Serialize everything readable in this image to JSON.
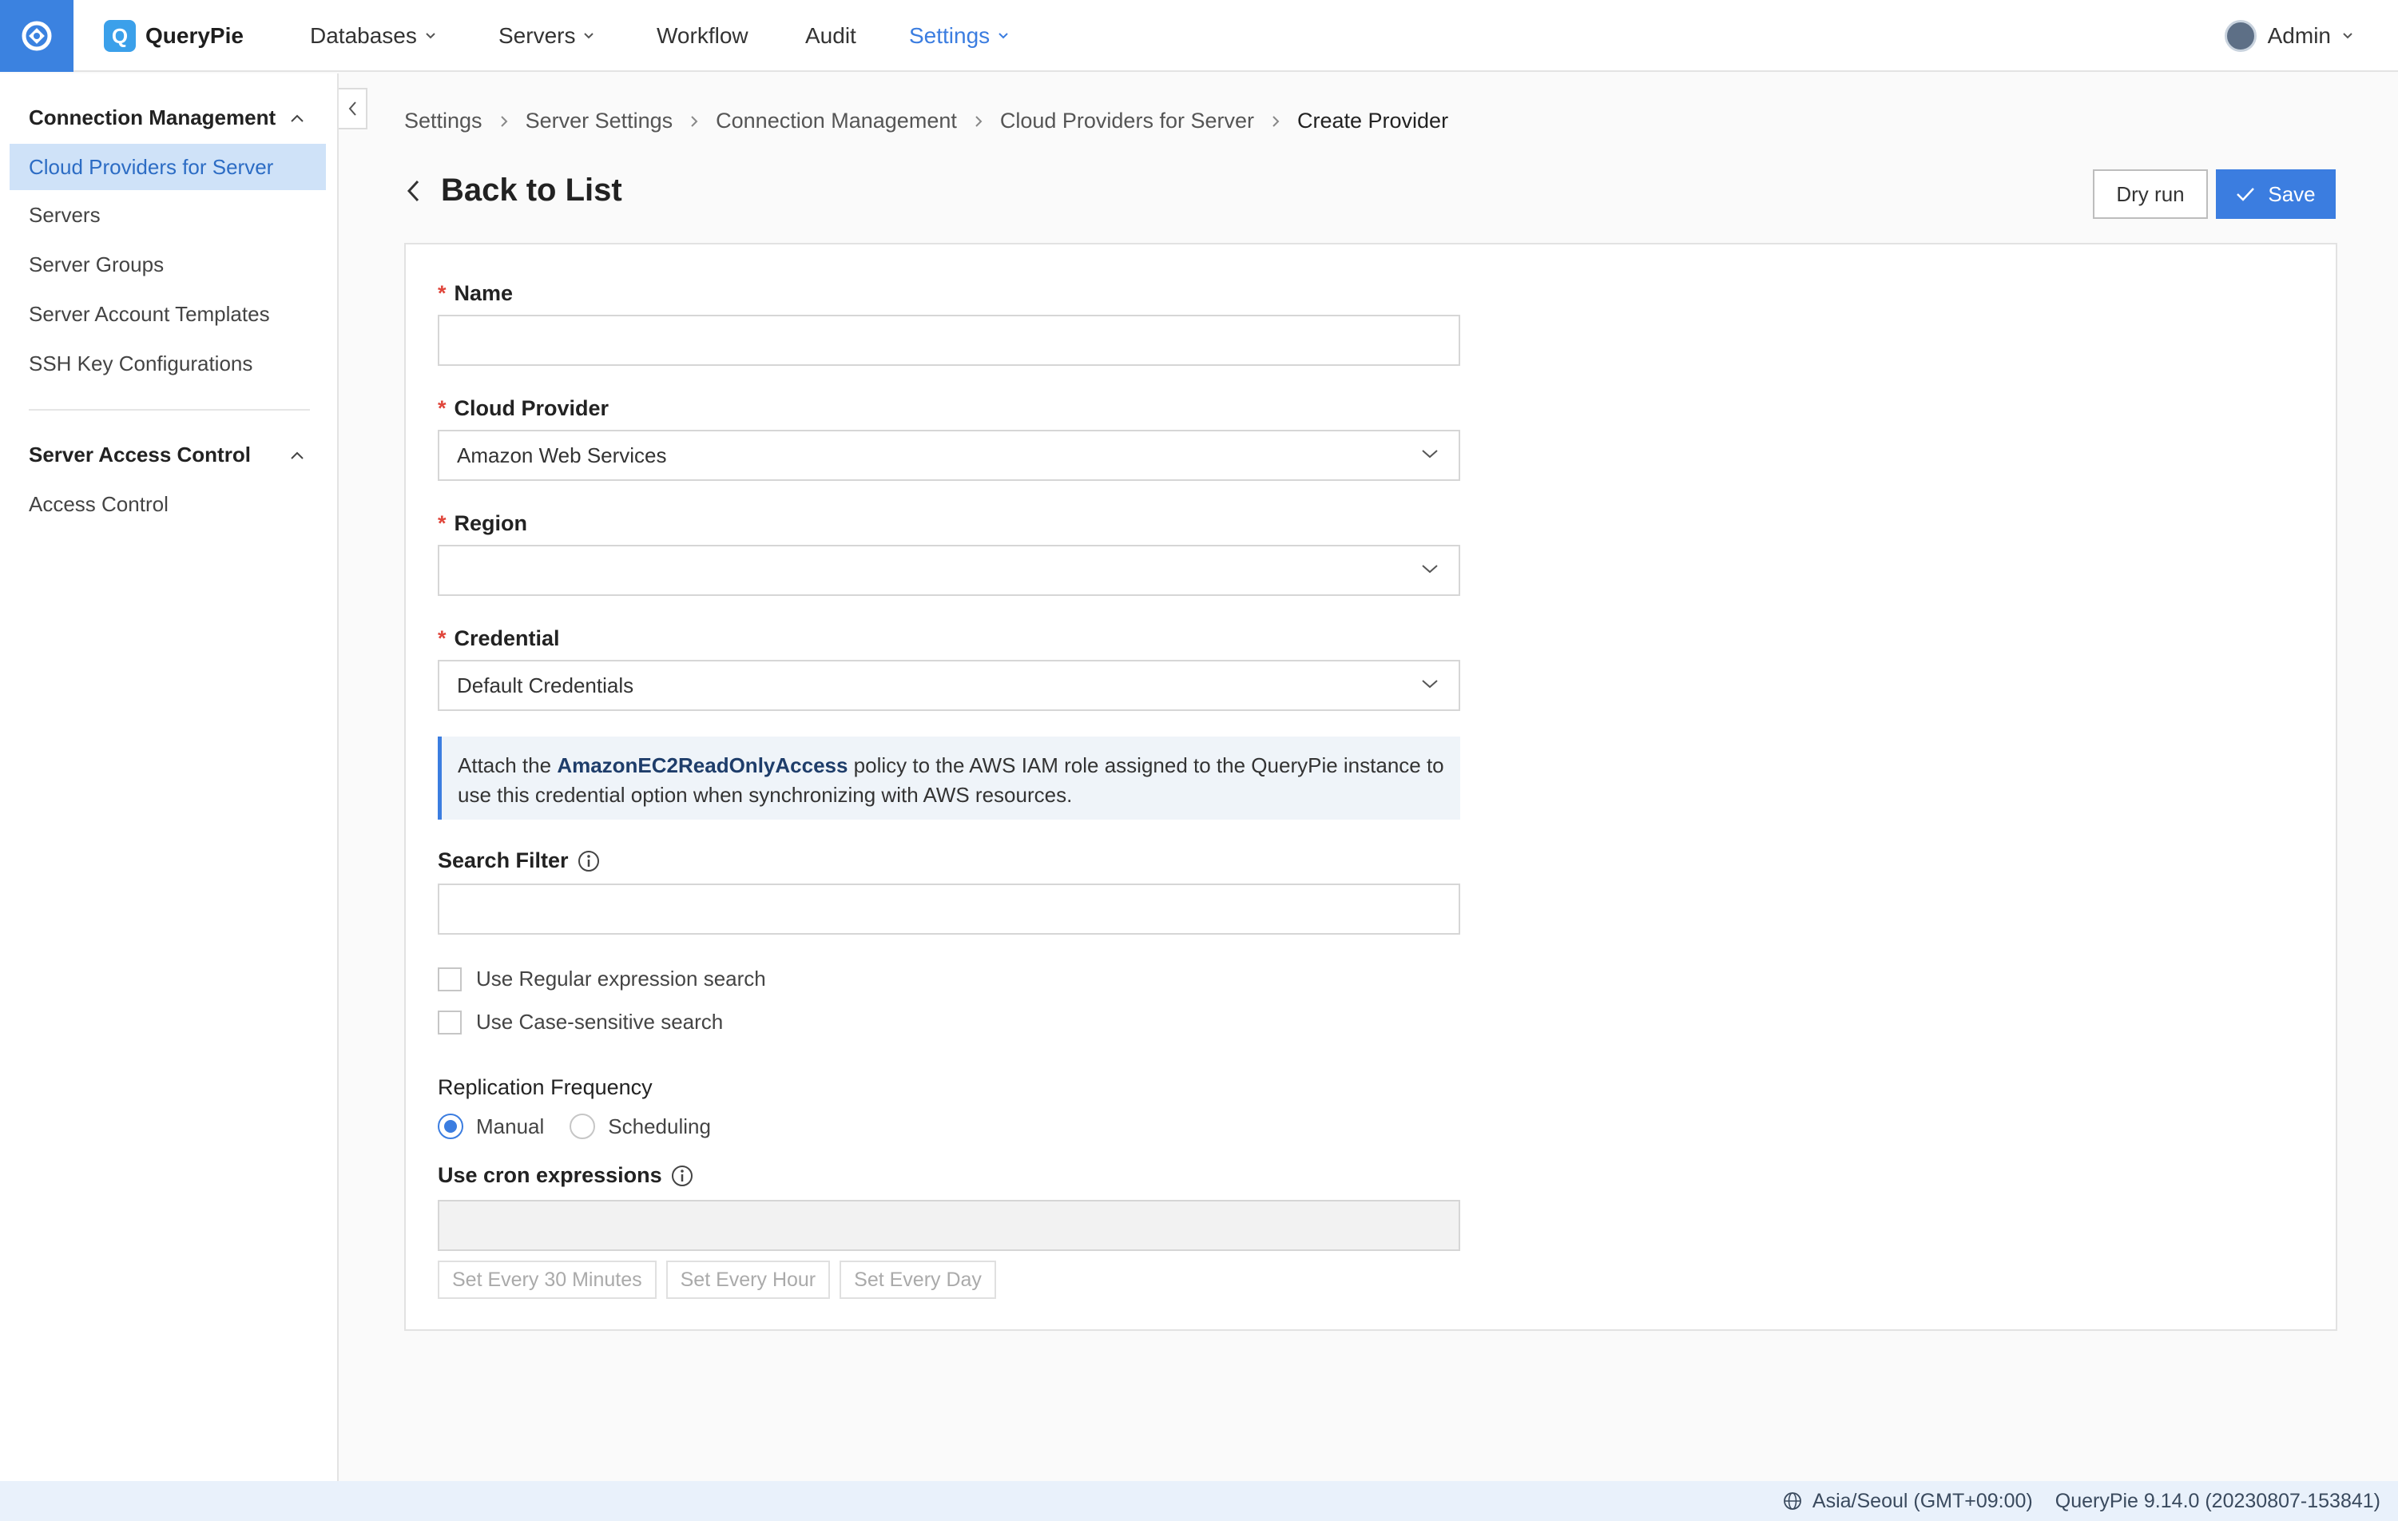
{
  "brand": {
    "badge": "Q",
    "name": "QueryPie"
  },
  "nav": [
    {
      "label": "Databases",
      "dropdown": true
    },
    {
      "label": "Servers",
      "dropdown": true
    },
    {
      "label": "Workflow",
      "dropdown": false
    },
    {
      "label": "Audit",
      "dropdown": false
    },
    {
      "label": "Settings",
      "dropdown": true,
      "active": true
    }
  ],
  "user": {
    "name": "Admin"
  },
  "sidebar": {
    "sections": [
      {
        "title": "Connection Management",
        "items": [
          "Cloud Providers for Server",
          "Servers",
          "Server Groups",
          "Server Account Templates",
          "SSH Key Configurations"
        ],
        "active_item": "Cloud Providers for Server"
      },
      {
        "title": "Server Access Control",
        "items": [
          "Access Control"
        ]
      }
    ]
  },
  "breadcrumb": [
    "Settings",
    "Server Settings",
    "Connection Management",
    "Cloud Providers for Server",
    "Create Provider"
  ],
  "page": {
    "back_label": "Back to List",
    "dry_run_label": "Dry run",
    "save_label": "Save"
  },
  "form": {
    "name": {
      "label": "Name",
      "value": ""
    },
    "cloud_provider": {
      "label": "Cloud Provider",
      "value": "Amazon Web Services"
    },
    "region": {
      "label": "Region",
      "value": ""
    },
    "credential": {
      "label": "Credential",
      "value": "Default Credentials"
    },
    "info": {
      "prefix": "Attach the ",
      "policy": "AmazonEC2ReadOnlyAccess",
      "suffix": " policy to the AWS IAM role assigned to the QueryPie instance to use this credential option when synchronizing with AWS resources."
    },
    "search_filter": {
      "label": "Search Filter",
      "value": ""
    },
    "checkboxes": [
      {
        "label": "Use Regular expression search",
        "checked": false
      },
      {
        "label": "Use Case-sensitive search",
        "checked": false
      }
    ],
    "replication": {
      "label": "Replication Frequency",
      "options": [
        "Manual",
        "Scheduling"
      ],
      "selected": "Manual"
    },
    "cron": {
      "label": "Use cron expressions",
      "value": "",
      "presets": [
        "Set Every 30 Minutes",
        "Set Every Hour",
        "Set Every Day"
      ]
    }
  },
  "footer": {
    "timezone": "Asia/Seoul (GMT+09:00)",
    "version": "QueryPie 9.14.0 (20230807-153841)"
  },
  "colors": {
    "accent": "#3b7de0",
    "sidebar_active_bg": "#cfe2f8",
    "required": "#e0453a",
    "footer_bg": "#e9f1fb"
  }
}
